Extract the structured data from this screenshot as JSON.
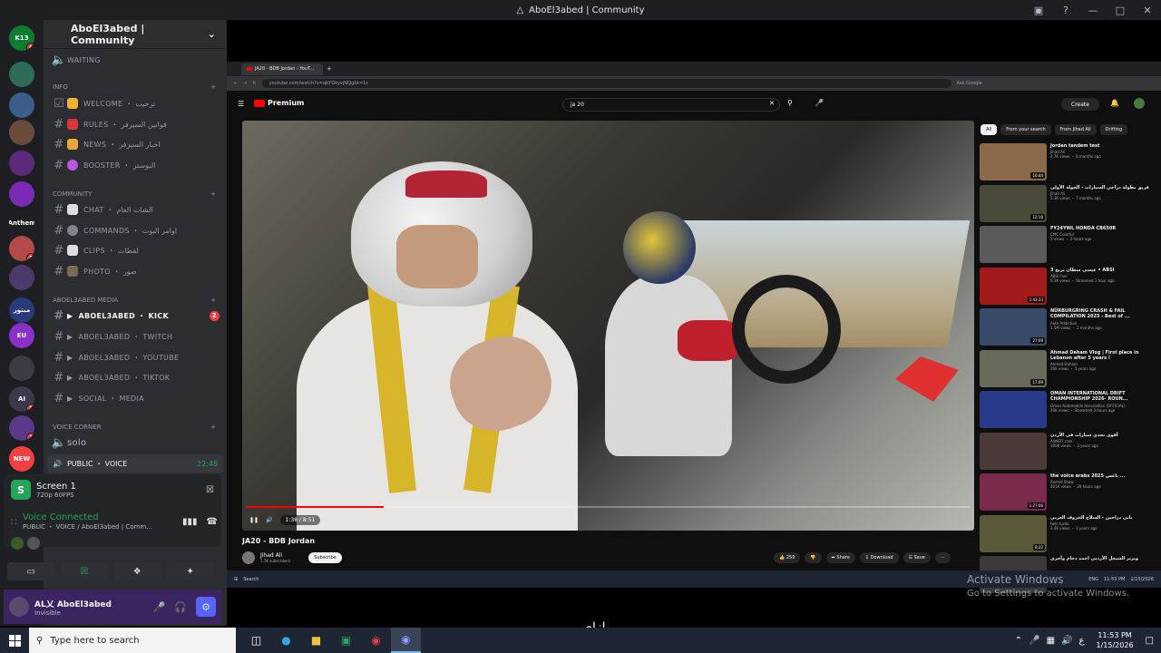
{
  "window": {
    "title": "AboEl3abed | Community"
  },
  "servers": [
    {
      "label": "K13",
      "color": "#0a7d2e",
      "badge": "6"
    },
    {
      "label": "",
      "color": "#2f6b5a",
      "badge": ""
    },
    {
      "label": "",
      "color": "#3c5d8a",
      "badge": ""
    },
    {
      "label": "",
      "color": "#6a4a3a",
      "badge": ""
    },
    {
      "label": "",
      "color": "#5b2a7a",
      "badge": ""
    },
    {
      "label": "",
      "color": "#7a2ab5",
      "badge": ""
    },
    {
      "label": "Anthem",
      "color": "#1e1f22",
      "badge": ""
    },
    {
      "label": "",
      "color": "#b34a4a",
      "badge": "3"
    },
    {
      "label": "",
      "color": "#4a3a6a",
      "badge": ""
    },
    {
      "label": "مبتور",
      "color": "#2a3a7a",
      "badge": ""
    },
    {
      "label": "EU",
      "color": "#8b2fc9",
      "badge": ""
    },
    {
      "label": "",
      "color": "#3b3d44",
      "badge": ""
    },
    {
      "label": "AI",
      "color": "#3a3a4a",
      "badge": "3"
    },
    {
      "label": "",
      "color": "#5a3a8a",
      "badge": "1"
    },
    {
      "label": "NEW",
      "color": "#f23f43",
      "badge": ""
    }
  ],
  "guild": {
    "name": "AboEl3abed | Community"
  },
  "channels": {
    "waiting": "WAITING",
    "cat_info": "INFO",
    "welcome": "WELCOME ・ ترحيب",
    "rules": "RULES ・ قوانين السيرفر",
    "news": "NEWS ・ اخبار السيرفر",
    "booster": "BOOSTER ・ البوستر",
    "cat_community": "COMMUNITY",
    "chat": "CHAT ・ الشات العام",
    "commands": "COMMANDS ・ اوامر البوت",
    "clips": "CLIPS ・ لقطات",
    "photo": "PHOTO ・ صور",
    "cat_media": "ABOEL3ABED MEDIA",
    "kick": "ABOEL3ABED ・ KICK",
    "kick_badge": "2",
    "twitch": "ABOEL3ABED ・ TWITCH",
    "youtube": "ABOEL3ABED ・ YOUTUBE",
    "tiktok": "ABOEL3ABED ・ TIKTOK",
    "social": "SOCIAL ・ MEDIA",
    "cat_voice": "VOICE CORNER",
    "solo": "solo",
    "public_voice": "PUBLIC ・ VOICE",
    "voice_time": "22:48"
  },
  "stream": {
    "title": "Screen 1",
    "quality": "720p 60FPS"
  },
  "voice": {
    "status": "Voice Connected",
    "location": "PUBLIC ・ VOICE / AboEl3abed | Comm..."
  },
  "user": {
    "name": "AL乂 AboEl3abed",
    "status": "Invisible"
  },
  "browser": {
    "tab_title": "JA20 - BDB Jordan - YouT...",
    "url": "youtube.com/watch?v=qbYGkyvjNQg&t=1s",
    "ask_google": "Ask Google"
  },
  "youtube": {
    "brand": "Premium",
    "search": "ja 20",
    "create": "Create",
    "video_title": "JA20 - BDB Jordan",
    "time": "1:38 / 8:51",
    "channel": "Jihad Ali",
    "subs": "1.7K subscribers",
    "subscribe": "Subscribe",
    "likes": "259",
    "share": "Share",
    "download": "Download",
    "save": "Save",
    "progress": 0.19,
    "chips": [
      "All",
      "From your search",
      "From Jihad Ali",
      "Drifting"
    ],
    "recs": [
      {
        "title": "Jordan tandem test",
        "channel": "Jihad Ali",
        "meta": "4.7K views ・ 8 months ago",
        "dur": "10:44",
        "color": "#8a6a4a"
      },
      {
        "title": "فريق بطولة دراجي السيارات - الجولة الأولى",
        "channel": "Jihad Ali",
        "meta": "5.3K views ・ 7 months ago",
        "dur": "12:18",
        "color": "#4a4a3a"
      },
      {
        "title": "FY24YWL HONDA CB650R",
        "channel": "CMC Colorful",
        "meta": "3 views ・ 3 hours ago",
        "dur": "",
        "color": "#5a5a5a"
      },
      {
        "title": "عيسى سطان يربح 3 • ABSI",
        "channel": "ABSI Fam",
        "meta": "6.3K views ・ Streamed 1 hour ago",
        "dur": "1:43:33",
        "color": "#a31a1a"
      },
      {
        "title": "NÜRBURGRING CRASH & FAIL COMPILATION 2025 - Best of ...",
        "channel": "Auto Addiction",
        "meta": "1.5M views ・ 2 months ago",
        "dur": "27:09",
        "color": "#3a4a6a"
      },
      {
        "title": "Ahmad Daham Vlog | First place in Lebanon after 5 years !",
        "channel": "Ahmad Daham",
        "meta": "26K views ・ 3 years ago",
        "dur": "17:09",
        "color": "#6a6a5a"
      },
      {
        "title": "OMAN INTERNATIONAL DRIFT CHAMPIONSHIP 2026- ROUN...",
        "channel": "Oman Automobile Association (OFFICIAL)",
        "meta": "20K views ・ Streamed 3 hours ago",
        "dur": "",
        "color": "#2a3a8a"
      },
      {
        "title": "أقوى تحدي سيارات في الأردن",
        "channel": "AldKD7.com",
        "meta": "100K views ・ 3 years ago",
        "dur": "",
        "color": "#4a3a3a"
      },
      {
        "title": "the voice arabs 2025 ناعس ...",
        "channel": "Rachid Show",
        "meta": "401K views ・ 29 hours ago",
        "dur": "1:27:06",
        "color": "#7a2a4a"
      },
      {
        "title": "باني دراجين - السلاح الخروف العربي",
        "channel": "twin turbo",
        "meta": "3.4K views ・ 3 years ago",
        "dur": "8:22",
        "color": "#5a5a3a"
      },
      {
        "title": "ويزير الشيغل الأردني احمد دحام وأجرى",
        "channel": "",
        "meta": "",
        "dur": "",
        "color": "#3a3a3a"
      }
    ]
  },
  "inner_taskbar": {
    "search": "Search",
    "time": "11:53 PM",
    "date": "1/15/2026",
    "lang": "ENG"
  },
  "activate": {
    "line1": "Activate Windows",
    "line2": "Go to Settings to activate Windows."
  },
  "caption": "إزاي",
  "taskbar": {
    "search_placeholder": "Type here to search",
    "time": "11:53 PM",
    "date": "1/15/2026",
    "lang": "ع"
  }
}
